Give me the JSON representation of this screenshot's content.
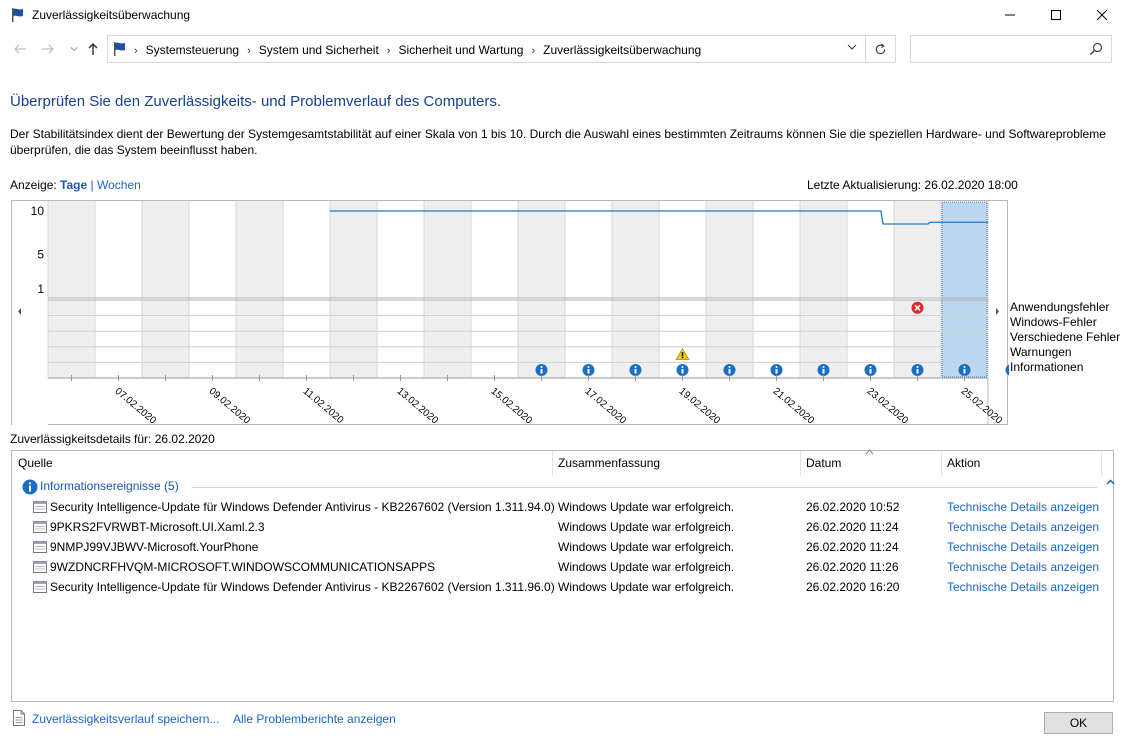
{
  "window": {
    "title": "Zuverlässigkeitsüberwachung",
    "controls": {
      "minimize": "─",
      "maximize": "☐",
      "close": "✕"
    }
  },
  "nav": {
    "breadcrumbs": [
      "Systemsteuerung",
      "System und Sicherheit",
      "Sicherheit und Wartung",
      "Zuverlässigkeitsüberwachung"
    ],
    "search_placeholder": ""
  },
  "header": {
    "title": "Überprüfen Sie den Zuverlässigkeits- und Problemverlauf des Computers.",
    "description": "Der Stabilitätsindex dient der Bewertung der Systemgesamtstabilität auf einer Skala von 1 bis 10. Durch die Auswahl eines bestimmten Zeitraums können Sie die speziellen Hardware- und Softwareprobleme überprüfen, die das System beeinflusst haben."
  },
  "view": {
    "label": "Anzeige:",
    "days": "Tage",
    "separator": "|",
    "weeks": "Wochen",
    "last_update": "Letzte Aktualisierung: 26.02.2020 18:00"
  },
  "chart_data": {
    "type": "line",
    "y_ticks": [
      "10",
      "5",
      "1"
    ],
    "ylim": [
      1,
      10
    ],
    "x_labels": [
      "07.02.2020",
      "09.02.2020",
      "11.02.2020",
      "13.02.2020",
      "15.02.2020",
      "17.02.2020",
      "19.02.2020",
      "21.02.2020",
      "23.02.2020",
      "25.02.2020"
    ],
    "days": [
      "06.02.2020",
      "07.02.2020",
      "08.02.2020",
      "09.02.2020",
      "10.02.2020",
      "11.02.2020",
      "12.02.2020",
      "13.02.2020",
      "14.02.2020",
      "15.02.2020",
      "16.02.2020",
      "17.02.2020",
      "18.02.2020",
      "19.02.2020",
      "20.02.2020",
      "21.02.2020",
      "22.02.2020",
      "23.02.2020",
      "24.02.2020",
      "25.02.2020"
    ],
    "stability_index": [
      null,
      null,
      null,
      null,
      null,
      null,
      10,
      10,
      10,
      10,
      10,
      10,
      10,
      10,
      10,
      10,
      10,
      10,
      8.5,
      8.7
    ],
    "selected_day": "26.02.2020",
    "event_rows": [
      "Anwendungsfehler",
      "Windows-Fehler",
      "Verschiedene Fehler",
      "Warnungen",
      "Informationen"
    ],
    "events": {
      "Anwendungsfehler": [
        "24.02.2020"
      ],
      "Windows-Fehler": [],
      "Verschiedene Fehler": [],
      "Warnungen": [
        "19.02.2020"
      ],
      "Informationen": [
        "16.02.2020",
        "17.02.2020",
        "18.02.2020",
        "19.02.2020",
        "20.02.2020",
        "21.02.2020",
        "22.02.2020",
        "23.02.2020",
        "24.02.2020",
        "25.02.2020",
        "26.02.2020"
      ]
    },
    "colors": {
      "line": "#1f7ac7",
      "selection": "#bcd8f1",
      "shade": "#efefef",
      "error": "#e0292b",
      "warning": "#f2c417",
      "info": "#1a6fc4"
    }
  },
  "details": {
    "label": "Zuverlässigkeitsdetails für: 26.02.2020",
    "columns": [
      "Quelle",
      "Zusammenfassung",
      "Datum",
      "Aktion"
    ],
    "group_label": "Informationsereignisse (5)",
    "rows": [
      {
        "source": "Security Intelligence-Update für Windows Defender Antivirus - KB2267602 (Version 1.311.94.0)",
        "summary": "Windows Update war erfolgreich.",
        "date": "26.02.2020 10:52",
        "action": "Technische Details anzeigen"
      },
      {
        "source": "9PKRS2FVRWBT-Microsoft.UI.Xaml.2.3",
        "summary": "Windows Update war erfolgreich.",
        "date": "26.02.2020 11:24",
        "action": "Technische Details anzeigen"
      },
      {
        "source": "9NMPJ99VJBWV-Microsoft.YourPhone",
        "summary": "Windows Update war erfolgreich.",
        "date": "26.02.2020 11:24",
        "action": "Technische Details anzeigen"
      },
      {
        "source": "9WZDNCRFHVQM-MICROSOFT.WINDOWSCOMMUNICATIONSAPPS",
        "summary": "Windows Update war erfolgreich.",
        "date": "26.02.2020 11:26",
        "action": "Technische Details anzeigen"
      },
      {
        "source": "Security Intelligence-Update für Windows Defender Antivirus - KB2267602 (Version 1.311.96.0)",
        "summary": "Windows Update war erfolgreich.",
        "date": "26.02.2020 16:20",
        "action": "Technische Details anzeigen"
      }
    ]
  },
  "footer": {
    "save_history": "Zuverlässigkeitsverlauf speichern...",
    "all_reports": "Alle Problemberichte anzeigen",
    "ok": "OK"
  }
}
